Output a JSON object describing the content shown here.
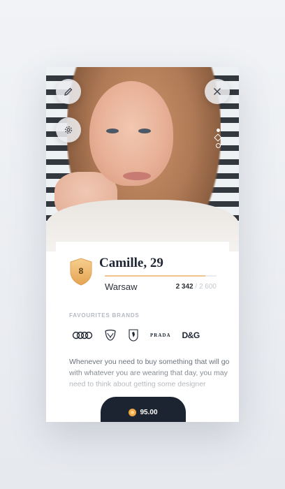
{
  "profile": {
    "name_age": "Camille, 29",
    "city": "Warsaw",
    "level": "8",
    "points_current": "2 342",
    "points_separator": "/",
    "points_max": "2 600",
    "progress_fraction": 0.9
  },
  "actions": {
    "edit_icon": "pencil-icon",
    "settings_icon": "gear-icon",
    "close_icon": "close-icon"
  },
  "brands": {
    "title": "FAVOURITES BRANDS",
    "items": [
      "Audi",
      "Dodge",
      "Ferrari",
      "PRADA",
      "D&G"
    ]
  },
  "description": "Whenever you need to buy something that will go with whatever you are wearing that day, you may need to think about getting some designer",
  "price": {
    "value": "95.00",
    "icon": "coin-icon"
  },
  "colors": {
    "accent": "#f0c48a",
    "dark": "#1d2431"
  }
}
